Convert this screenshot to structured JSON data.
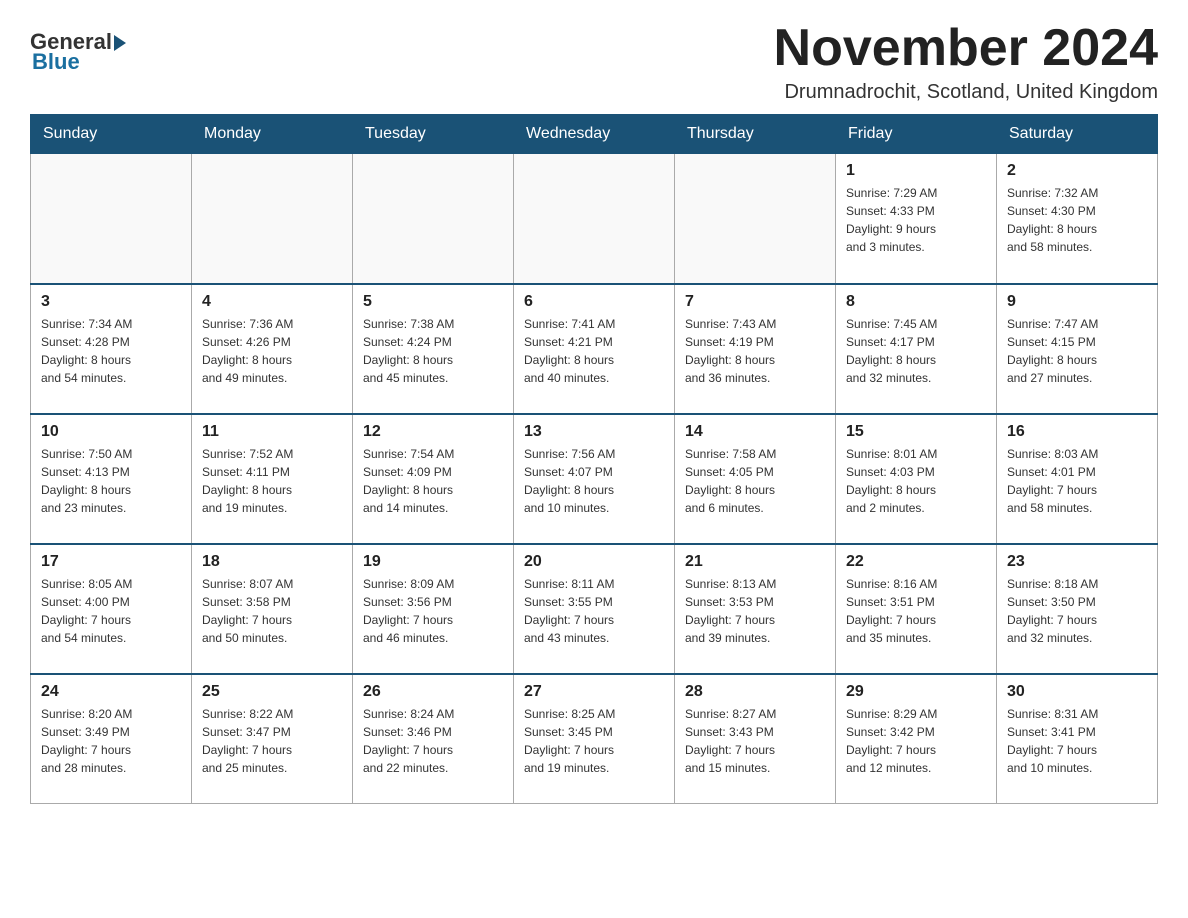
{
  "header": {
    "logo_text": "General",
    "logo_blue": "Blue",
    "month": "November 2024",
    "location": "Drumnadrochit, Scotland, United Kingdom"
  },
  "weekdays": [
    "Sunday",
    "Monday",
    "Tuesday",
    "Wednesday",
    "Thursday",
    "Friday",
    "Saturday"
  ],
  "weeks": [
    [
      {
        "day": "",
        "info": ""
      },
      {
        "day": "",
        "info": ""
      },
      {
        "day": "",
        "info": ""
      },
      {
        "day": "",
        "info": ""
      },
      {
        "day": "",
        "info": ""
      },
      {
        "day": "1",
        "info": "Sunrise: 7:29 AM\nSunset: 4:33 PM\nDaylight: 9 hours\nand 3 minutes."
      },
      {
        "day": "2",
        "info": "Sunrise: 7:32 AM\nSunset: 4:30 PM\nDaylight: 8 hours\nand 58 minutes."
      }
    ],
    [
      {
        "day": "3",
        "info": "Sunrise: 7:34 AM\nSunset: 4:28 PM\nDaylight: 8 hours\nand 54 minutes."
      },
      {
        "day": "4",
        "info": "Sunrise: 7:36 AM\nSunset: 4:26 PM\nDaylight: 8 hours\nand 49 minutes."
      },
      {
        "day": "5",
        "info": "Sunrise: 7:38 AM\nSunset: 4:24 PM\nDaylight: 8 hours\nand 45 minutes."
      },
      {
        "day": "6",
        "info": "Sunrise: 7:41 AM\nSunset: 4:21 PM\nDaylight: 8 hours\nand 40 minutes."
      },
      {
        "day": "7",
        "info": "Sunrise: 7:43 AM\nSunset: 4:19 PM\nDaylight: 8 hours\nand 36 minutes."
      },
      {
        "day": "8",
        "info": "Sunrise: 7:45 AM\nSunset: 4:17 PM\nDaylight: 8 hours\nand 32 minutes."
      },
      {
        "day": "9",
        "info": "Sunrise: 7:47 AM\nSunset: 4:15 PM\nDaylight: 8 hours\nand 27 minutes."
      }
    ],
    [
      {
        "day": "10",
        "info": "Sunrise: 7:50 AM\nSunset: 4:13 PM\nDaylight: 8 hours\nand 23 minutes."
      },
      {
        "day": "11",
        "info": "Sunrise: 7:52 AM\nSunset: 4:11 PM\nDaylight: 8 hours\nand 19 minutes."
      },
      {
        "day": "12",
        "info": "Sunrise: 7:54 AM\nSunset: 4:09 PM\nDaylight: 8 hours\nand 14 minutes."
      },
      {
        "day": "13",
        "info": "Sunrise: 7:56 AM\nSunset: 4:07 PM\nDaylight: 8 hours\nand 10 minutes."
      },
      {
        "day": "14",
        "info": "Sunrise: 7:58 AM\nSunset: 4:05 PM\nDaylight: 8 hours\nand 6 minutes."
      },
      {
        "day": "15",
        "info": "Sunrise: 8:01 AM\nSunset: 4:03 PM\nDaylight: 8 hours\nand 2 minutes."
      },
      {
        "day": "16",
        "info": "Sunrise: 8:03 AM\nSunset: 4:01 PM\nDaylight: 7 hours\nand 58 minutes."
      }
    ],
    [
      {
        "day": "17",
        "info": "Sunrise: 8:05 AM\nSunset: 4:00 PM\nDaylight: 7 hours\nand 54 minutes."
      },
      {
        "day": "18",
        "info": "Sunrise: 8:07 AM\nSunset: 3:58 PM\nDaylight: 7 hours\nand 50 minutes."
      },
      {
        "day": "19",
        "info": "Sunrise: 8:09 AM\nSunset: 3:56 PM\nDaylight: 7 hours\nand 46 minutes."
      },
      {
        "day": "20",
        "info": "Sunrise: 8:11 AM\nSunset: 3:55 PM\nDaylight: 7 hours\nand 43 minutes."
      },
      {
        "day": "21",
        "info": "Sunrise: 8:13 AM\nSunset: 3:53 PM\nDaylight: 7 hours\nand 39 minutes."
      },
      {
        "day": "22",
        "info": "Sunrise: 8:16 AM\nSunset: 3:51 PM\nDaylight: 7 hours\nand 35 minutes."
      },
      {
        "day": "23",
        "info": "Sunrise: 8:18 AM\nSunset: 3:50 PM\nDaylight: 7 hours\nand 32 minutes."
      }
    ],
    [
      {
        "day": "24",
        "info": "Sunrise: 8:20 AM\nSunset: 3:49 PM\nDaylight: 7 hours\nand 28 minutes."
      },
      {
        "day": "25",
        "info": "Sunrise: 8:22 AM\nSunset: 3:47 PM\nDaylight: 7 hours\nand 25 minutes."
      },
      {
        "day": "26",
        "info": "Sunrise: 8:24 AM\nSunset: 3:46 PM\nDaylight: 7 hours\nand 22 minutes."
      },
      {
        "day": "27",
        "info": "Sunrise: 8:25 AM\nSunset: 3:45 PM\nDaylight: 7 hours\nand 19 minutes."
      },
      {
        "day": "28",
        "info": "Sunrise: 8:27 AM\nSunset: 3:43 PM\nDaylight: 7 hours\nand 15 minutes."
      },
      {
        "day": "29",
        "info": "Sunrise: 8:29 AM\nSunset: 3:42 PM\nDaylight: 7 hours\nand 12 minutes."
      },
      {
        "day": "30",
        "info": "Sunrise: 8:31 AM\nSunset: 3:41 PM\nDaylight: 7 hours\nand 10 minutes."
      }
    ]
  ]
}
